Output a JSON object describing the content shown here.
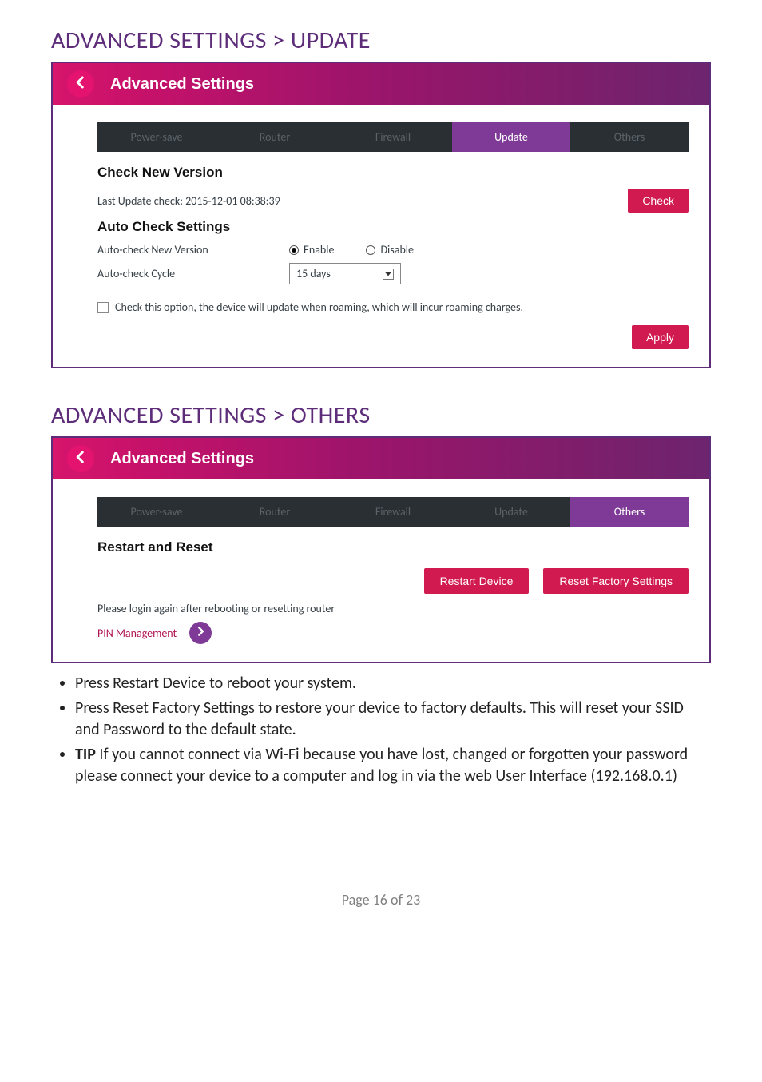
{
  "sections": {
    "update": {
      "heading": "ADVANCED SETTINGS > UPDATE",
      "panel_title": "Advanced Settings",
      "tabs": {
        "powersave": "Power-save",
        "router": "Router",
        "firewall": "Firewall",
        "update": "Update",
        "others": "Others"
      },
      "check_new_version": {
        "title": "Check New Version",
        "last_check": "Last Update check: 2015-12-01 08:38:39",
        "check_btn": "Check"
      },
      "auto_check": {
        "title": "Auto Check Settings",
        "new_version_label": "Auto-check New Version",
        "radio_enable": "Enable",
        "radio_disable": "Disable",
        "cycle_label": "Auto-check Cycle",
        "cycle_value": "15 days",
        "roaming_label": "Check this option, the device will update when roaming, which will incur roaming charges.",
        "apply_btn": "Apply"
      }
    },
    "others": {
      "heading": "ADVANCED SETTINGS > OTHERS",
      "panel_title": "Advanced Settings",
      "tabs": {
        "powersave": "Power-save",
        "router": "Router",
        "firewall": "Firewall",
        "update": "Update",
        "others": "Others"
      },
      "restart_reset": {
        "title": "Restart and Reset",
        "restart_btn": "Restart Device",
        "reset_btn": "Reset Factory Settings",
        "note": "Please login again after rebooting or resetting router",
        "pin_link": "PIN Management"
      }
    }
  },
  "doc_bullets": {
    "b1": "Press Restart Device to reboot your system.",
    "b2": "Press Reset Factory Settings to restore your device to factory defaults. This will reset your SSID and Password to the default state.",
    "b3_bold": "TIP",
    "b3_rest": " If you cannot connect via Wi-Fi because you have lost, changed or forgotten your password please connect your device to a computer and log in via the web User Interface (192.168.0.1)"
  },
  "footer": "Page 16 of 23"
}
